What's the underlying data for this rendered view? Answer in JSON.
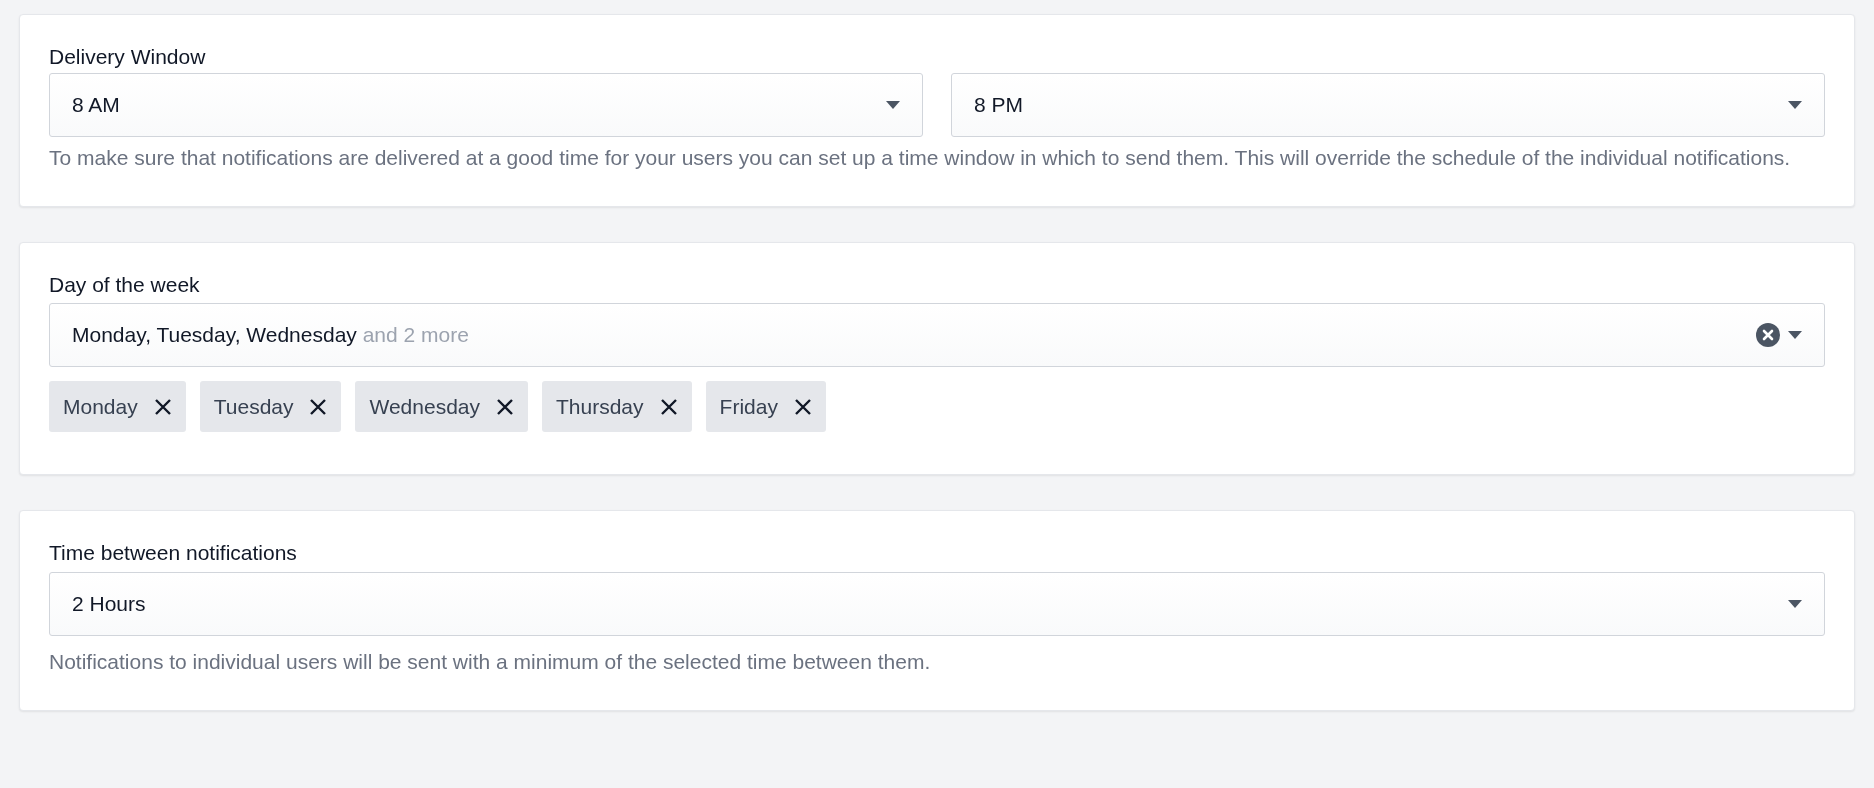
{
  "delivery_window": {
    "label": "Delivery Window",
    "selects": [
      "8 AM",
      "8 PM"
    ],
    "help": "To make sure that notifications are delivered at a good time for your users you can set up a time window in which to send them. This will override the schedule of the individual notifications."
  },
  "day_of_week": {
    "label": "Day of the week",
    "summary": "Monday, Tuesday, Wednesday",
    "summary_more": "and 2 more",
    "tags": [
      "Monday",
      "Tuesday",
      "Wednesday",
      "Thursday",
      "Friday"
    ]
  },
  "time_between": {
    "label": "Time between notifications",
    "value": "2 Hours",
    "help": "Notifications to individual users will be sent with a minimum of the selected time between them."
  }
}
